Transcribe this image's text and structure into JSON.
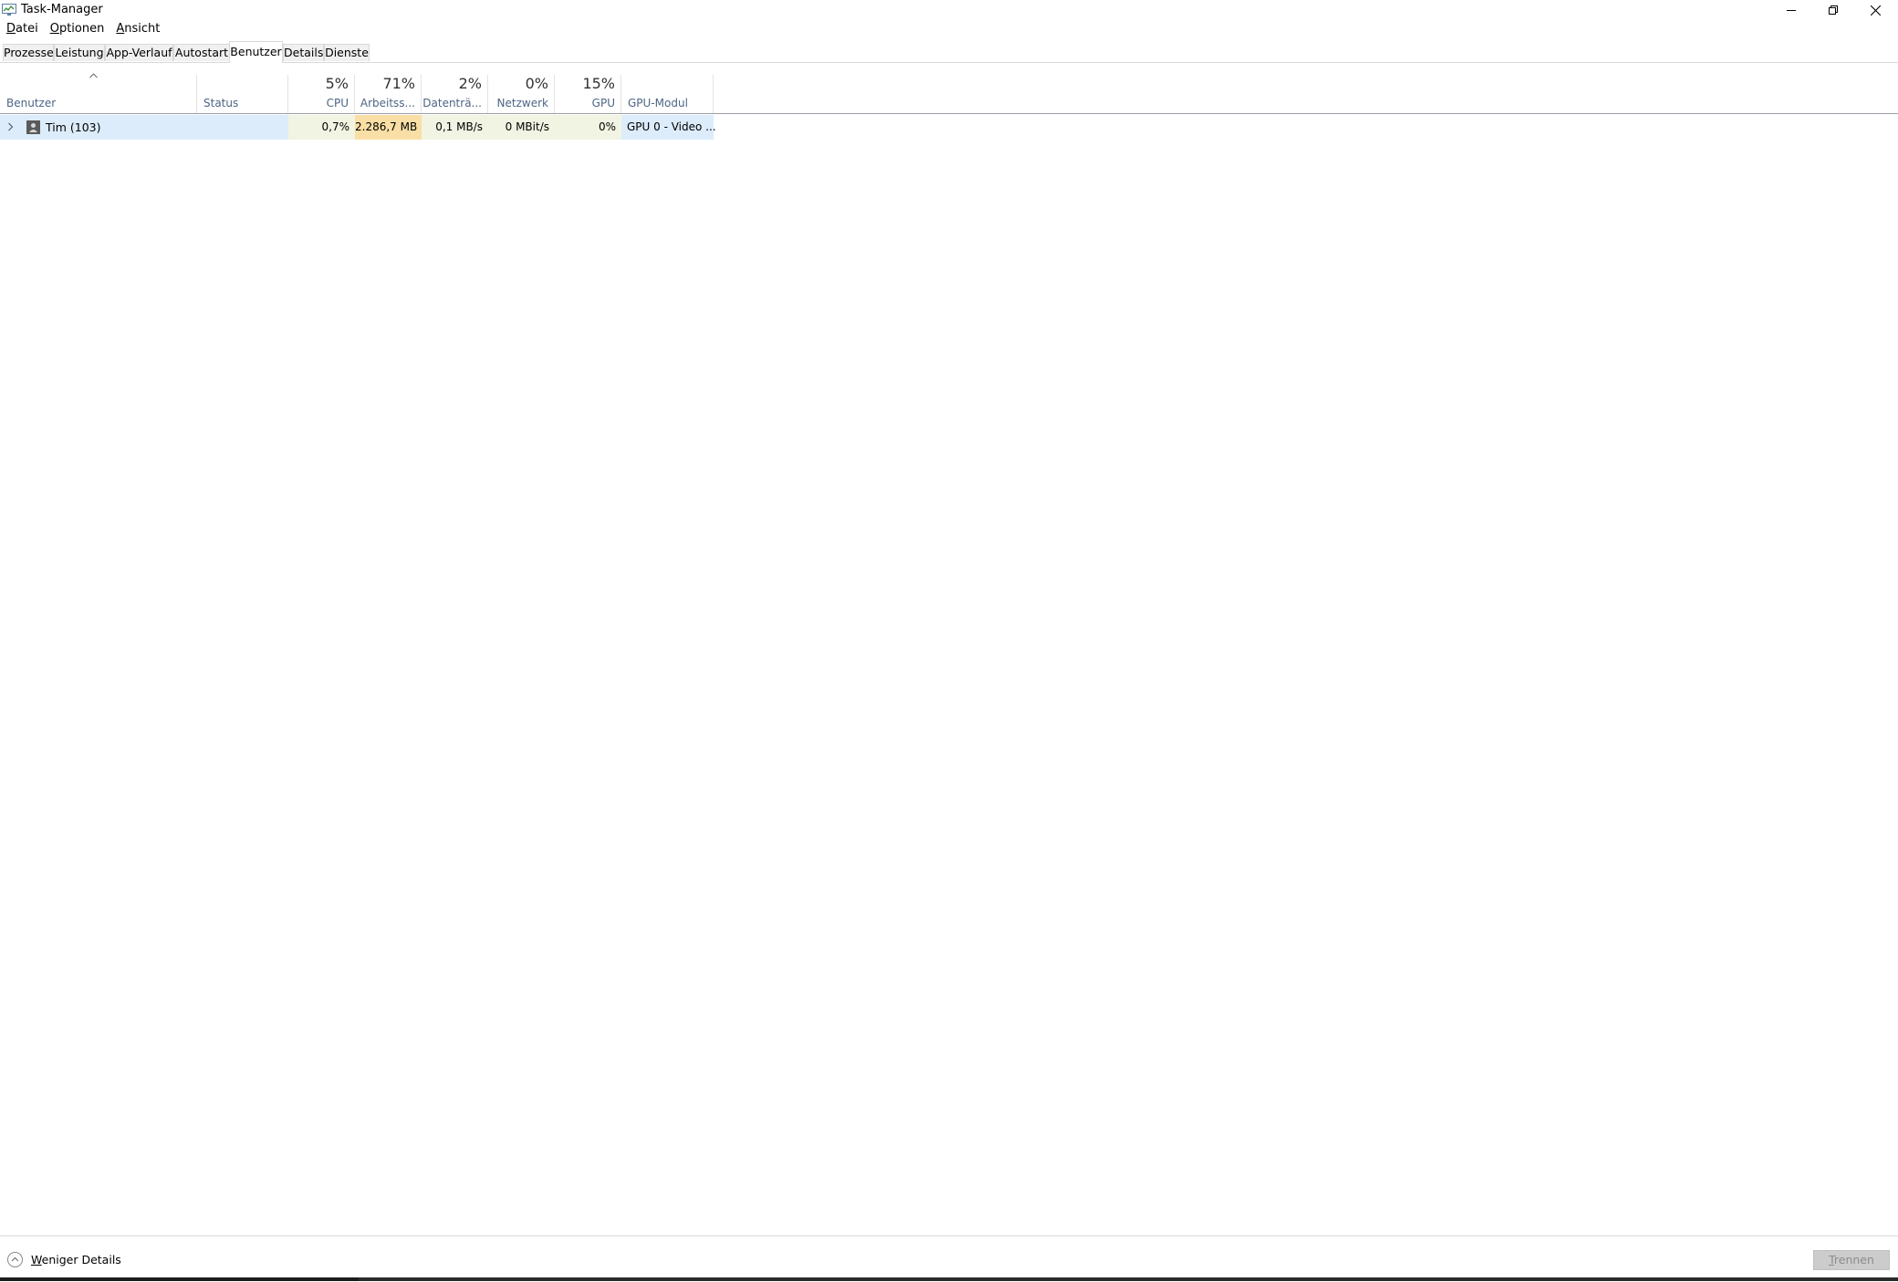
{
  "window": {
    "title": "Task-Manager",
    "icons": {
      "app": "task-manager-icon",
      "minimize": "minimize-icon",
      "restore": "restore-icon",
      "close": "close-icon"
    }
  },
  "menu": {
    "items": [
      {
        "first": "D",
        "rest": "atei"
      },
      {
        "first": "O",
        "rest": "ptionen"
      },
      {
        "first": "A",
        "rest": "nsicht"
      }
    ]
  },
  "tabs": [
    {
      "label": "Prozesse",
      "active": false
    },
    {
      "label": "Leistung",
      "active": false
    },
    {
      "label": "App-Verlauf",
      "active": false
    },
    {
      "label": "Autostart",
      "active": false
    },
    {
      "label": "Benutzer",
      "active": true
    },
    {
      "label": "Details",
      "active": false
    },
    {
      "label": "Dienste",
      "active": false
    }
  ],
  "columns": {
    "user": {
      "label": "Benutzer",
      "sort": "ascending"
    },
    "status": {
      "label": "Status"
    },
    "cpu": {
      "percent": "5%",
      "label": "CPU"
    },
    "memory": {
      "percent": "71%",
      "label": "Arbeitss..."
    },
    "disk": {
      "percent": "2%",
      "label": "Datenträ..."
    },
    "network": {
      "percent": "0%",
      "label": "Netzwerk"
    },
    "gpu": {
      "percent": "15%",
      "label": "GPU"
    },
    "gpu_engine": {
      "label": "GPU-Modul"
    }
  },
  "rows": [
    {
      "name": "Tim (103)",
      "status": "",
      "cpu": "0,7%",
      "memory": "2.286,7 MB",
      "disk": "0,1 MB/s",
      "network": "0 MBit/s",
      "gpu": "0%",
      "gpu_engine": "GPU 0 - Video ..."
    }
  ],
  "colors": {
    "row_selected": "#dcecfb",
    "heat_light": "#f1f4e3",
    "heat_memory": "#f9dfa5",
    "header_label": "#4d6584"
  },
  "footer": {
    "less_details_first": "W",
    "less_details_rest": "eniger Details",
    "disconnect_first": "T",
    "disconnect_rest": "rennen"
  }
}
